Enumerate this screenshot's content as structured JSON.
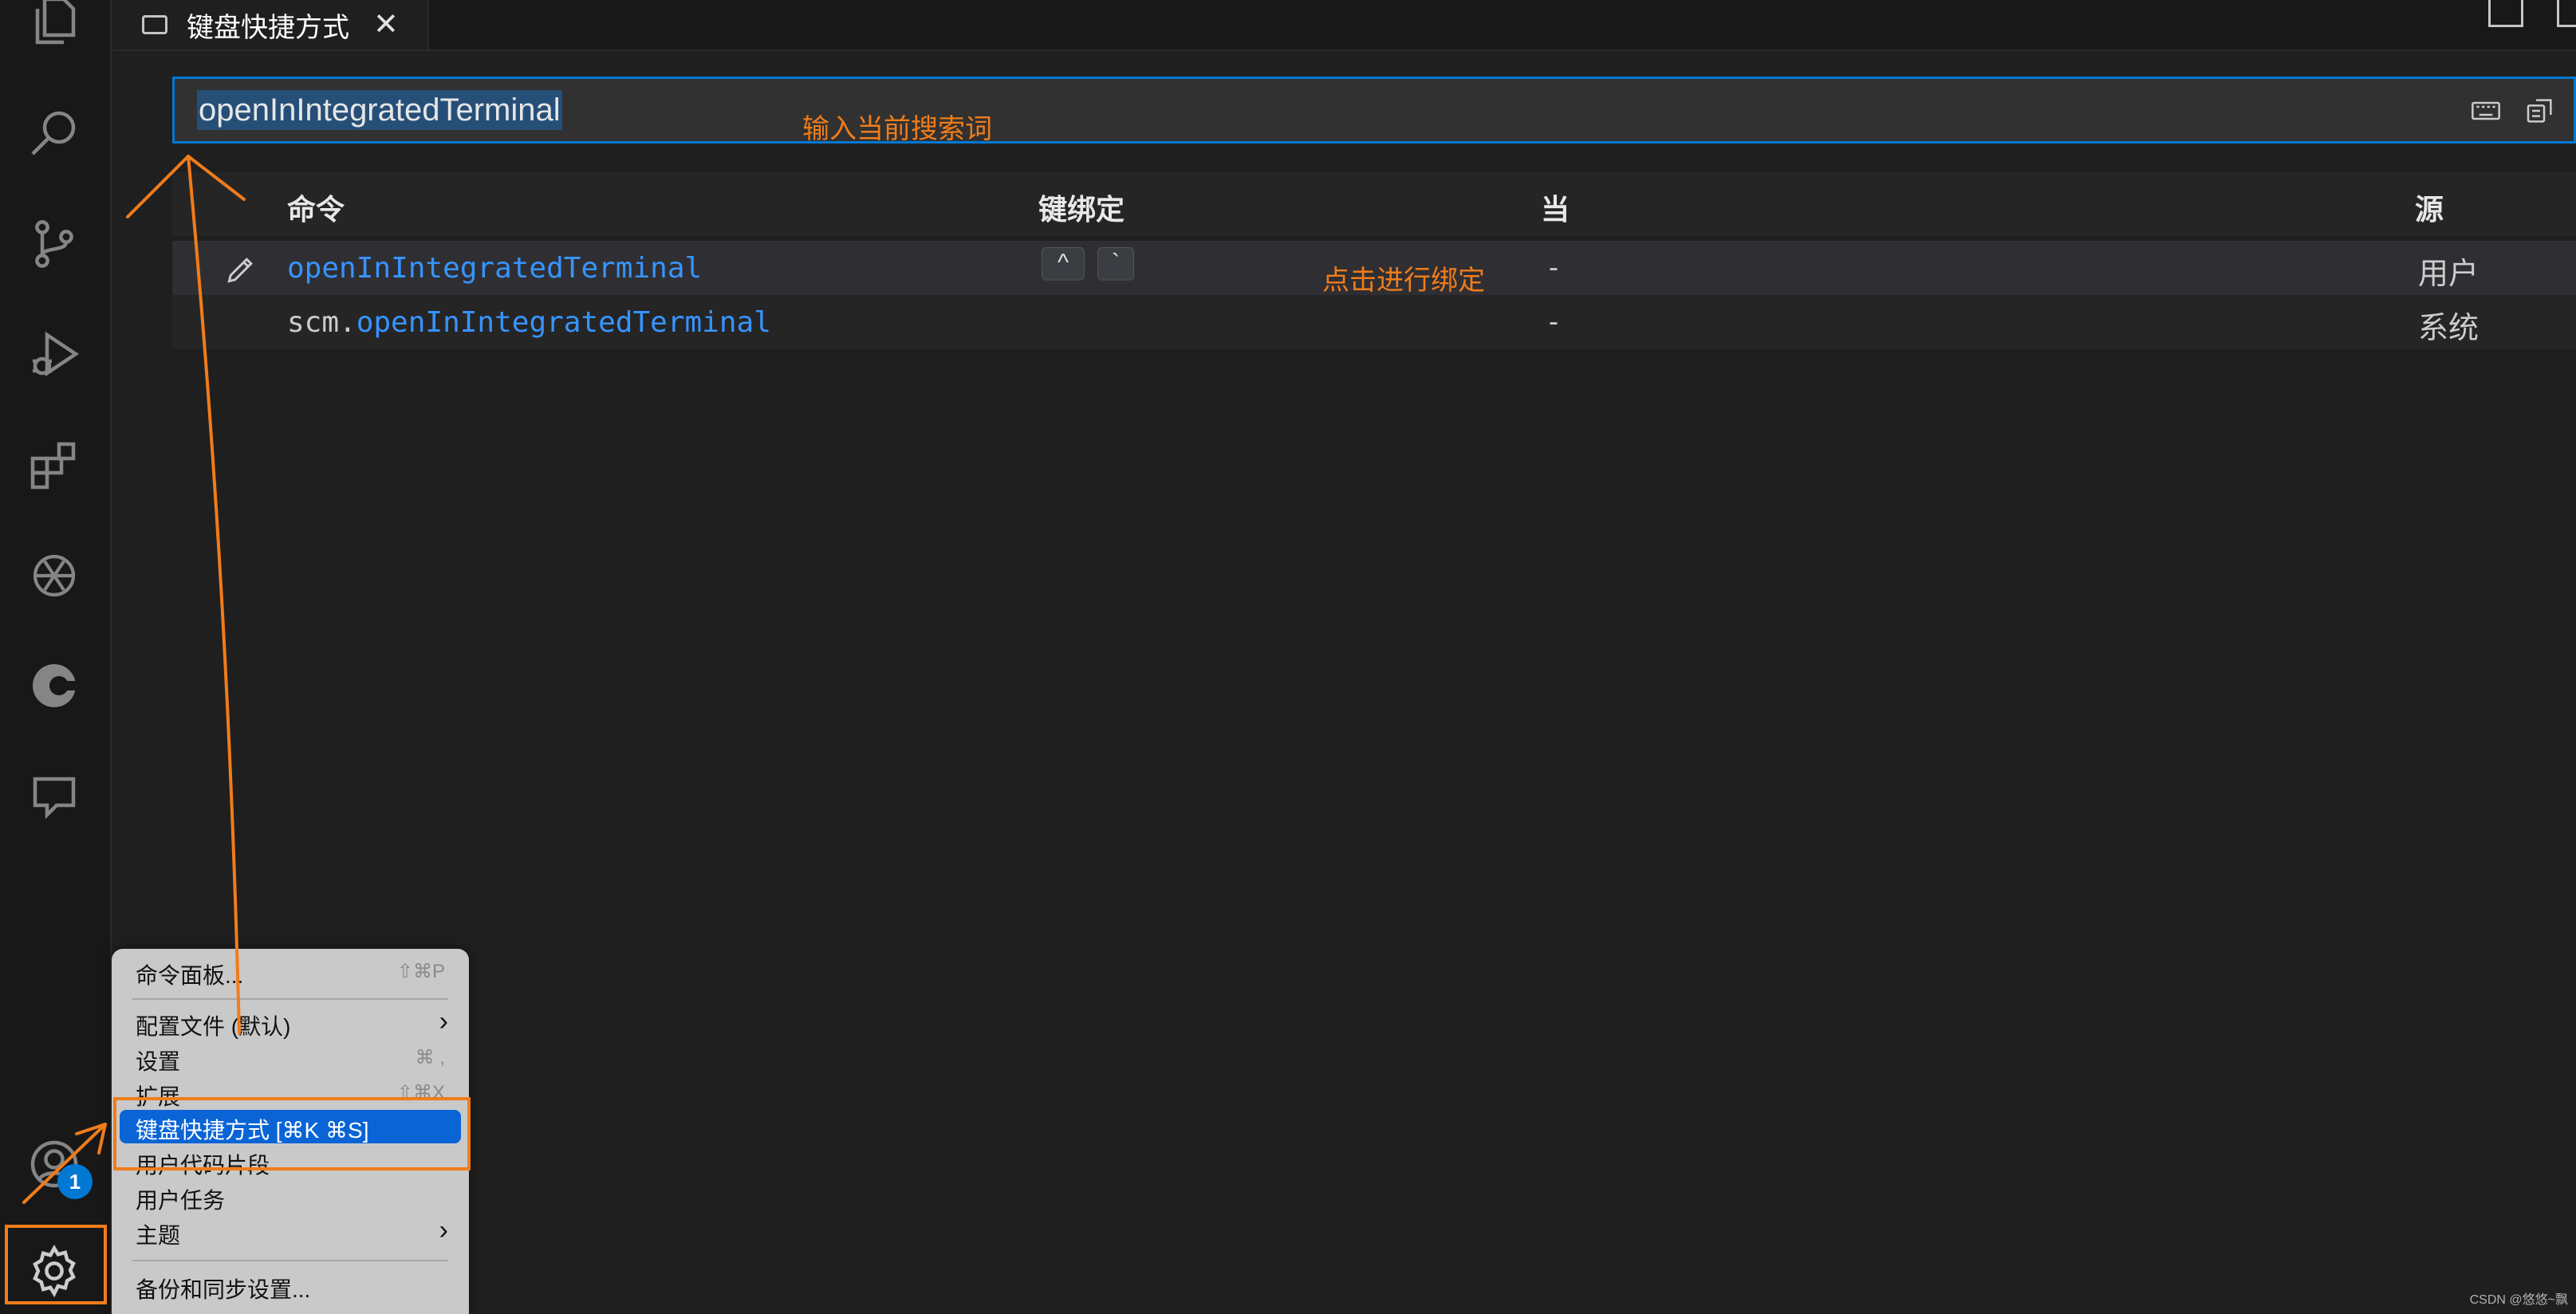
{
  "tab": {
    "title": "键盘快捷方式",
    "close": "✕"
  },
  "search": {
    "value": "openInIntegratedTerminal"
  },
  "table": {
    "headers": {
      "command": "命令",
      "keybinding": "键绑定",
      "when": "当",
      "source": "源"
    },
    "rows": [
      {
        "prefix": "",
        "command": "openInIntegratedTerminal",
        "keys": [
          "^",
          "`"
        ],
        "when": "-",
        "source": "用户"
      },
      {
        "prefix": "scm.",
        "command": "openInIntegratedTerminal",
        "keys": [],
        "when": "-",
        "source": "系统"
      }
    ]
  },
  "annotations": {
    "search_hint": "输入当前搜索词",
    "bind_hint": "点击进行绑定"
  },
  "accounts_badge": "1",
  "menu": {
    "items": [
      {
        "label": "命令面板...",
        "shortcut": "⇧⌘P"
      },
      {
        "label": "配置文件 (默认)",
        "arrow": "›"
      },
      {
        "label": "设置",
        "shortcut": "⌘ ,"
      },
      {
        "label": "扩展",
        "shortcut": "⇧⌘X"
      },
      {
        "label": "键盘快捷方式 [⌘K ⌘S]"
      },
      {
        "label": "用户代码片段"
      },
      {
        "label": "用户任务"
      },
      {
        "label": "主题",
        "arrow": "›"
      },
      {
        "label": "备份和同步设置..."
      }
    ]
  },
  "watermark": "CSDN @悠悠~飘",
  "colors": {
    "accent": "#0078d4",
    "annotation": "#f07c1b",
    "link": "#3794ff",
    "menu_active": "#0a64d6"
  }
}
